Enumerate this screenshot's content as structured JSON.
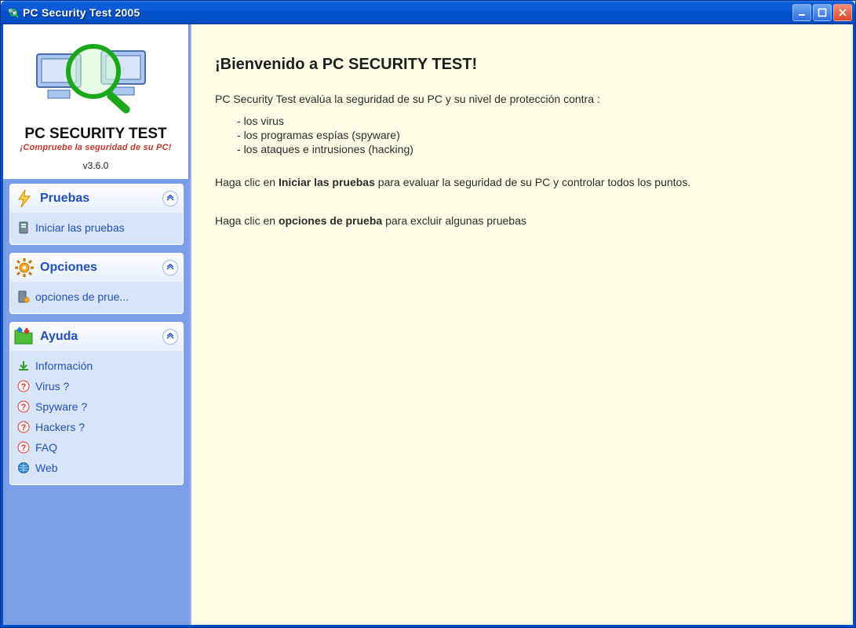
{
  "window": {
    "title": "PC Security Test 2005"
  },
  "logo": {
    "title": "PC SECURITY TEST",
    "subtitle": "¡Compruebe la seguridad de su PC!",
    "version": "v3.6.0"
  },
  "sidebar": {
    "groups": {
      "tests": {
        "label": "Pruebas",
        "items": {
          "start": "Iniciar las pruebas"
        }
      },
      "options": {
        "label": "Opciones",
        "items": {
          "opts": "opciones de prue..."
        }
      },
      "help": {
        "label": "Ayuda",
        "items": {
          "info": "Información",
          "virus": "Virus ?",
          "spyware": "Spyware ?",
          "hackers": "Hackers ?",
          "faq": "FAQ",
          "web": "Web"
        }
      }
    }
  },
  "main": {
    "heading": "¡Bienvenido a PC SECURITY TEST!",
    "intro": "PC Security Test evalúa la seguridad de su PC y su nivel de protección contra :",
    "bullets": {
      "b1": "los virus",
      "b2": "los programas espías (spyware)",
      "b3": "los ataques e intrusiones (hacking)"
    },
    "line2": {
      "pre": "Haga clic en ",
      "bold": "Iniciar las pruebas",
      "post": " para evaluar la seguridad de su PC y controlar todos los puntos."
    },
    "line3": {
      "pre": "Haga clic en ",
      "bold": "opciones de prueba",
      "post": " para excluir algunas pruebas"
    }
  }
}
